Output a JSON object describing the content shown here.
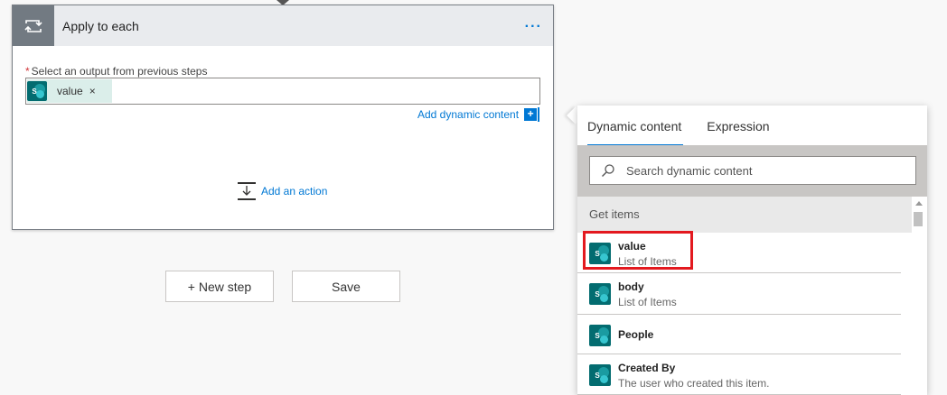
{
  "card": {
    "title": "Apply to each",
    "more_label": "...",
    "field_required_mark": "*",
    "field_label": "Select an output from previous steps",
    "token_label": "value",
    "token_remove": "×",
    "add_dynamic_label": "Add dynamic content",
    "add_dynamic_plus": "+",
    "add_action_label": "Add an action"
  },
  "buttons": {
    "new_step": "+ New step",
    "save": "Save"
  },
  "panel": {
    "tabs": [
      {
        "label": "Dynamic content",
        "active": true
      },
      {
        "label": "Expression",
        "active": false
      }
    ],
    "search_placeholder": "Search dynamic content",
    "group_label": "Get items",
    "items": [
      {
        "name": "value",
        "desc": "List of Items",
        "highlighted": true
      },
      {
        "name": "body",
        "desc": "List of Items"
      },
      {
        "name": "People",
        "desc": ""
      },
      {
        "name": "Created By",
        "desc": "The user who created this item."
      }
    ]
  },
  "colors": {
    "accent": "#0078d4",
    "sharepoint": "#036c70",
    "highlight": "#e3191f",
    "required": "#d13438"
  }
}
